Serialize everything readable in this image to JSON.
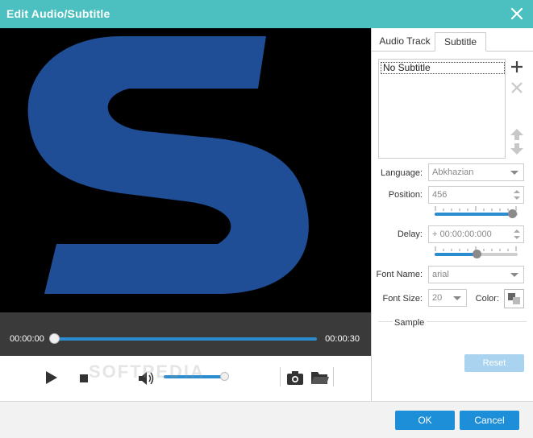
{
  "window": {
    "title": "Edit Audio/Subtitle"
  },
  "player": {
    "current_time": "00:00:00",
    "total_time": "00:00:30",
    "progress_fraction": 0.0,
    "volume_fraction": 0.9
  },
  "watermark": "SOFTPEDIA",
  "tabs": [
    {
      "label": "Audio Track",
      "active": false
    },
    {
      "label": "Subtitle",
      "active": true
    }
  ],
  "subtitles": {
    "items": [
      "No Subtitle"
    ]
  },
  "settings": {
    "language_label": "Language:",
    "language_value": "Abkhazian",
    "position_label": "Position:",
    "position_value": "456",
    "position_fraction": 0.93,
    "delay_label": "Delay:",
    "delay_value": "+  00:00:00:000",
    "delay_fraction": 0.5,
    "font_name_label": "Font Name:",
    "font_name_value": "arial",
    "font_size_label": "Font Size:",
    "font_size_value": "20",
    "color_label": "Color:",
    "sample_label": "Sample"
  },
  "buttons": {
    "reset": "Reset",
    "ok": "OK",
    "cancel": "Cancel"
  },
  "colors": {
    "accent": "#4cc0c0",
    "primary": "#1d8ed8",
    "progress": "#2b8ccf",
    "logo_blue": "#1f4e96"
  }
}
